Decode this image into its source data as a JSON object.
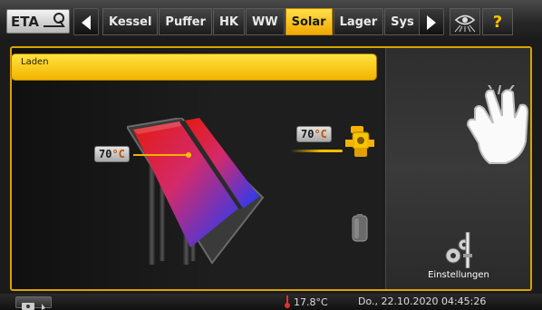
{
  "header": {
    "logo_icon": "eta-logo-icon",
    "tabs": [
      {
        "label": "Kessel"
      },
      {
        "label": "Puffer"
      },
      {
        "label": "HK"
      },
      {
        "label": "WW"
      },
      {
        "label": "Solar",
        "active": true
      },
      {
        "label": "Lager"
      },
      {
        "label": "Sys"
      }
    ],
    "left_arrow_icon": "arrow-left-icon",
    "right_arrow_icon": "arrow-right-icon",
    "view_icon": "eye-network-icon",
    "help_label": "?"
  },
  "status": {
    "label": "Laden"
  },
  "collector": {
    "temp_value": "70",
    "temp_unit": "°C"
  },
  "storage": {
    "temp_value": "70",
    "temp_unit": "°C"
  },
  "settings": {
    "label": "Einstellungen",
    "icon": "gears-icon"
  },
  "footer": {
    "outdoor_temp": "17.8°C",
    "datetime": "Do., 22.10.2020 04:45:26",
    "camera_icon": "camera-icon"
  },
  "colors": {
    "accent": "#f2b400",
    "active_tab": "#ffd21e",
    "collector_red": "#e8261c",
    "collector_blue": "#1e4cff"
  }
}
